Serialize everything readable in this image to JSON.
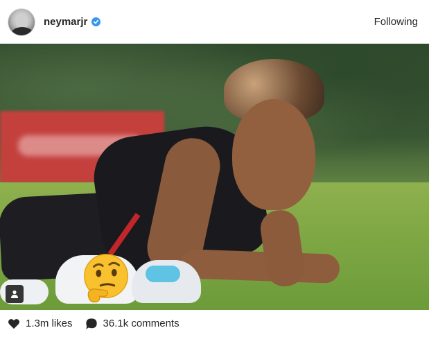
{
  "header": {
    "username": "neymarjr",
    "follow_label": "Following",
    "verified_color": "#3897f0"
  },
  "post": {
    "image_overlay_emoji": "thinking-face-emoji",
    "tag_icon": "user-tag-icon"
  },
  "footer": {
    "likes": "1.3m likes",
    "comments": "36.1k comments",
    "like_icon": "heart-icon",
    "comment_icon": "comment-bubble-icon"
  }
}
